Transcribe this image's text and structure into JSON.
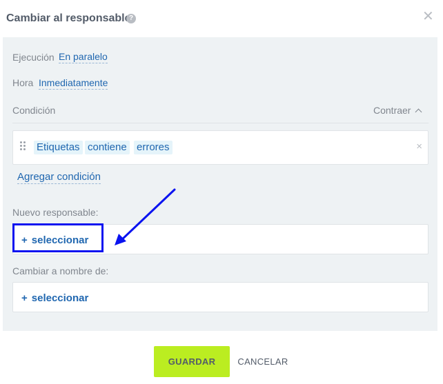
{
  "dialog": {
    "title": "Cambiar al responsable",
    "help_icon": "help-icon",
    "close_icon": "close-icon"
  },
  "settings": {
    "execution_label": "Ejecución",
    "execution_value": "En paralelo",
    "time_label": "Hora",
    "time_value": "Inmediatamente"
  },
  "condition": {
    "label": "Condición",
    "collapse_label": "Contraer",
    "chips": [
      "Etiquetas",
      "contiene",
      "errores"
    ],
    "remove_icon": "×",
    "add_label": "Agregar condición"
  },
  "new_responsible": {
    "label": "Nuevo responsable:",
    "button_label": "seleccionar"
  },
  "change_name": {
    "label": "Cambiar a nombre de:",
    "button_label": "seleccionar"
  },
  "footer": {
    "save_label": "GUARDAR",
    "cancel_label": "CANCELAR"
  },
  "colors": {
    "accent": "#2067b0",
    "save_button": "#bbed21",
    "annotation": "#0a13f0"
  }
}
